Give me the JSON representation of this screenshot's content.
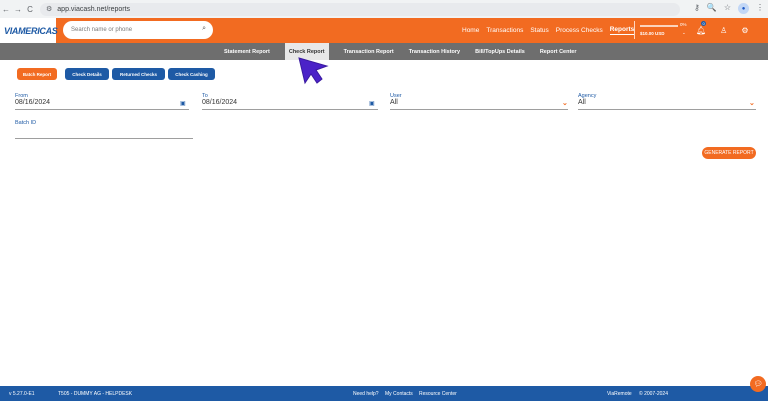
{
  "browser": {
    "url": "app.viacash.net/reports",
    "back": "←",
    "forward": "→",
    "reload": "C",
    "key_icon": "⚷",
    "zoom_icon": "🔍",
    "star_icon": "☆",
    "menu_icon": "⋮"
  },
  "header": {
    "logo": "VIAMERICAS",
    "search_placeholder": "Search name or phone",
    "nav": [
      "Home",
      "Transactions",
      "Status",
      "Process Checks",
      "Reports"
    ],
    "active_nav": "Reports",
    "balance": {
      "percent": "0%",
      "percent_value": 0,
      "amount": "$10.00 USD"
    },
    "notifications_count": "0",
    "accent_color": "#f26b21",
    "brand_color": "#1e5aa5"
  },
  "subnav": {
    "items": [
      "Statement Report",
      "Check Report",
      "Transaction Report",
      "Transaction History",
      "Bill/TopUps Details",
      "Report Center"
    ],
    "active": "Check Report"
  },
  "actions": {
    "batch_report": "Batch Report",
    "check_details": "Check Details",
    "returned_checks": "Returned Checks",
    "check_cashing": "Check Cashing"
  },
  "filters": {
    "from_label": "From",
    "from_value": "08/16/2024",
    "to_label": "To",
    "to_value": "08/16/2024",
    "user_label": "User",
    "user_value": "All",
    "agency_label": "Agency",
    "agency_value": "All",
    "batch_label": "Batch ID",
    "batch_value": ""
  },
  "generate_button": "GENERATE REPORT",
  "footer": {
    "version": "v 5.27.0-E1",
    "agency": "T505 - DUMMY AG - HELPDESK",
    "need_help": "Need help?",
    "contacts": "My Contacts",
    "resource": "Resource Center",
    "brand": "ViaRemote",
    "copyright": "© 2007-2024"
  }
}
